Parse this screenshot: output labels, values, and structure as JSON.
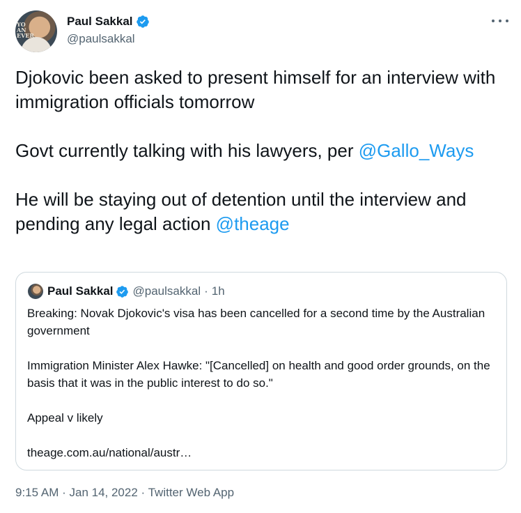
{
  "author": {
    "name": "Paul Sakkal",
    "handle": "@paulsakkal",
    "verified_color": "#1d9bf0",
    "avatar_sign": "YO AN EVER"
  },
  "menu": {
    "icon": "more-horizontal-icon"
  },
  "tweet": {
    "paragraphs": [
      {
        "text": "Djokovic been asked to present himself for an interview with immigration officials tomorrow"
      },
      {
        "text": "Govt currently talking with his lawyers, per ",
        "mention": "@Gallo_Ways"
      },
      {
        "text": "He will be staying out of detention until the interview and pending any legal action ",
        "mention": "@theage"
      }
    ]
  },
  "quoted_tweet": {
    "name": "Paul Sakkal",
    "handle": "@paulsakkal",
    "separator": "·",
    "time": "1h",
    "paragraphs": [
      "Breaking: Novak Djokovic's visa has been cancelled for a second time by the Australian government",
      "Immigration Minister Alex Hawke: \"[Cancelled] on health and good order grounds, on the basis that it was in the public interest to do so.\"",
      "Appeal v likely",
      "theage.com.au/national/austr…"
    ]
  },
  "meta": {
    "time": "9:15 AM",
    "separator": " · ",
    "date": "Jan 14, 2022",
    "source": "Twitter Web App"
  },
  "colors": {
    "text": "#0f1419",
    "secondary": "#536471",
    "link": "#1d9bf0",
    "border": "#cfd9de"
  }
}
